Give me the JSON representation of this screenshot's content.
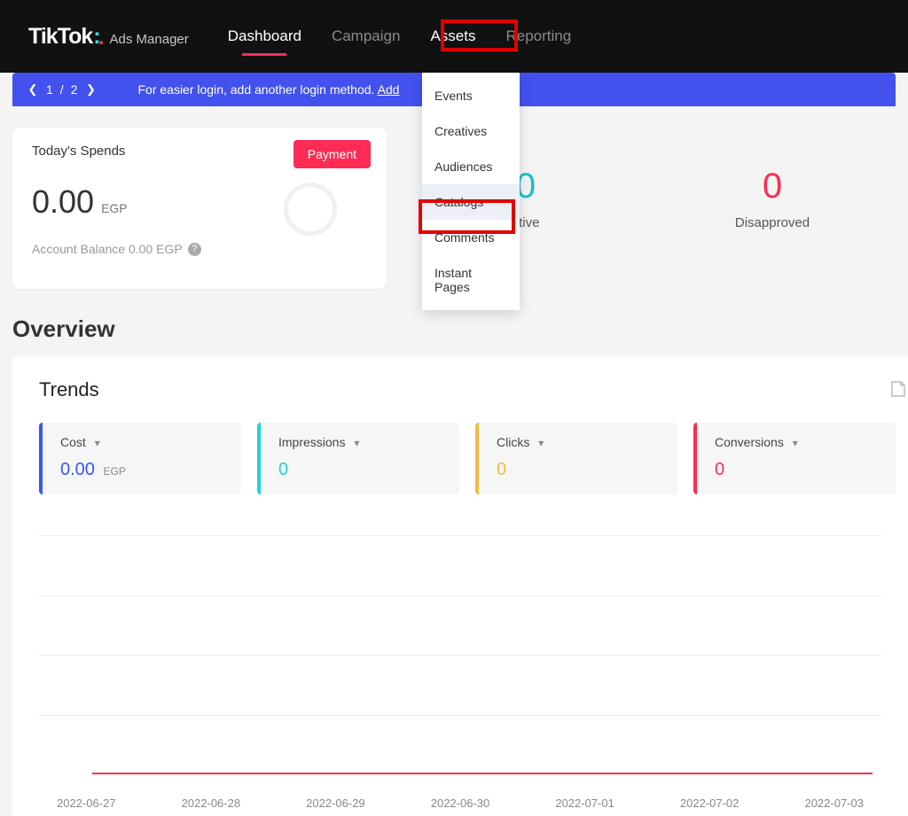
{
  "brand": {
    "logo": "TikTok",
    "sub": "Ads Manager"
  },
  "nav": [
    {
      "label": "Dashboard",
      "active": true
    },
    {
      "label": "Campaign"
    },
    {
      "label": "Assets",
      "white": true
    },
    {
      "label": "Reporting"
    }
  ],
  "notice": {
    "page_cur": "1",
    "sep": "/",
    "page_total": "2",
    "msg": "For easier login, add another login method.",
    "link": "Add"
  },
  "assets_menu": [
    {
      "label": "Events"
    },
    {
      "label": "Creatives"
    },
    {
      "label": "Audiences"
    },
    {
      "label": "Catalogs",
      "hl": true
    },
    {
      "label": "Comments"
    },
    {
      "label": "Instant Pages"
    }
  ],
  "spend": {
    "title": "Today's Spends",
    "payment_btn": "Payment",
    "value": "0.00",
    "currency": "EGP",
    "balance_label": "Account Balance 0.00 EGP"
  },
  "status": {
    "active_val": "0",
    "active_label": "ctive",
    "disapproved_val": "0",
    "disapproved_label": "Disapproved"
  },
  "overview_h": "Overview",
  "trends_h": "Trends",
  "metrics": {
    "cost": {
      "label": "Cost",
      "value": "0.00",
      "currency": "EGP"
    },
    "impressions": {
      "label": "Impressions",
      "value": "0"
    },
    "clicks": {
      "label": "Clicks",
      "value": "0"
    },
    "conversions": {
      "label": "Conversions",
      "value": "0"
    }
  },
  "chart_data": {
    "type": "line",
    "title": "",
    "xlabel": "",
    "ylabel": "",
    "ylim": [
      0,
      1
    ],
    "categories": [
      "2022-06-27",
      "2022-06-28",
      "2022-06-29",
      "2022-06-30",
      "2022-07-01",
      "2022-07-02",
      "2022-07-03"
    ],
    "series": [
      {
        "name": "Cost",
        "values": [
          0,
          0,
          0,
          0,
          0,
          0,
          0
        ]
      },
      {
        "name": "Impressions",
        "values": [
          0,
          0,
          0,
          0,
          0,
          0,
          0
        ]
      },
      {
        "name": "Clicks",
        "values": [
          0,
          0,
          0,
          0,
          0,
          0,
          0
        ]
      },
      {
        "name": "Conversions",
        "values": [
          0,
          0,
          0,
          0,
          0,
          0,
          0
        ]
      }
    ]
  }
}
